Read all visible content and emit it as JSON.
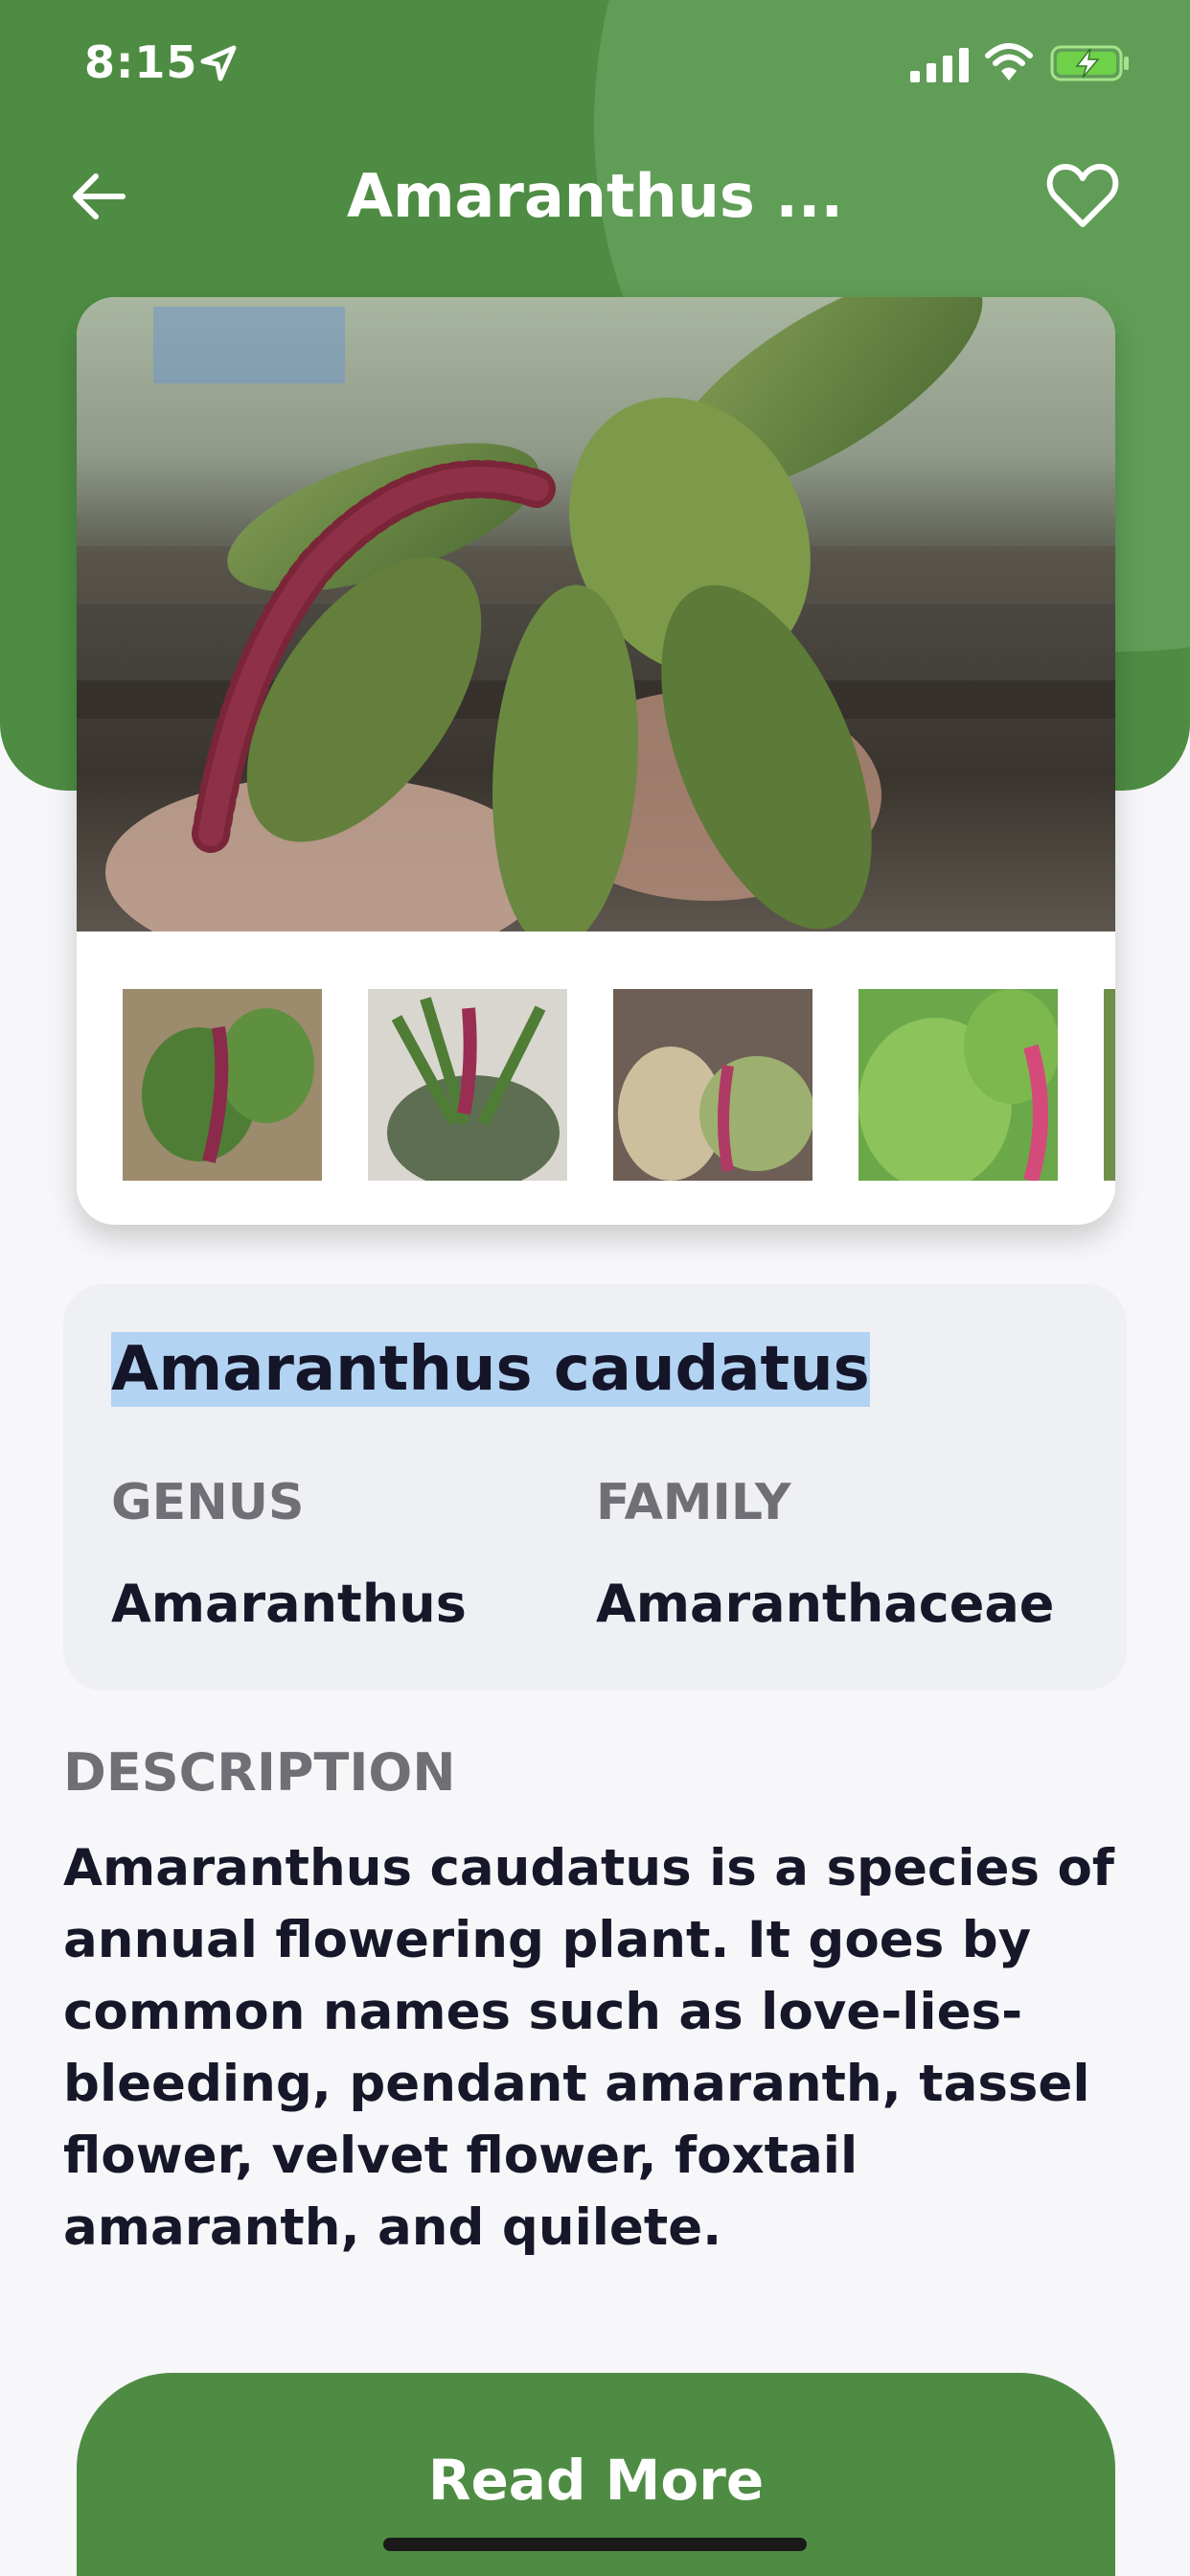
{
  "status_bar": {
    "time": "8:15",
    "icons": [
      "location-arrow-icon",
      "signal-icon",
      "wifi-icon",
      "battery-charging-icon"
    ]
  },
  "nav": {
    "title": "Amaranthus ...",
    "back_icon": "back-arrow-icon",
    "favorite_icon": "heart-icon"
  },
  "gallery": {
    "hero_alt": "Amaranthus caudatus plant with red tassel flower",
    "thumbnail_count": 5
  },
  "plant": {
    "name": "Amaranthus caudatus",
    "genus_label": "GENUS",
    "genus": "Amaranthus",
    "family_label": "FAMILY",
    "family": "Amaranthaceae"
  },
  "description": {
    "label": "DESCRIPTION",
    "text": "Amaranthus caudatus is a species of annual flowering plant. It goes by common names such as love-lies-bleeding, pendant amaranth, tassel flower, velvet flower, foxtail amaranth, and quilete."
  },
  "actions": {
    "read_more": "Read More"
  },
  "colors": {
    "brand_green": "#4e8c43",
    "selection_highlight": "#b3d3f2"
  }
}
